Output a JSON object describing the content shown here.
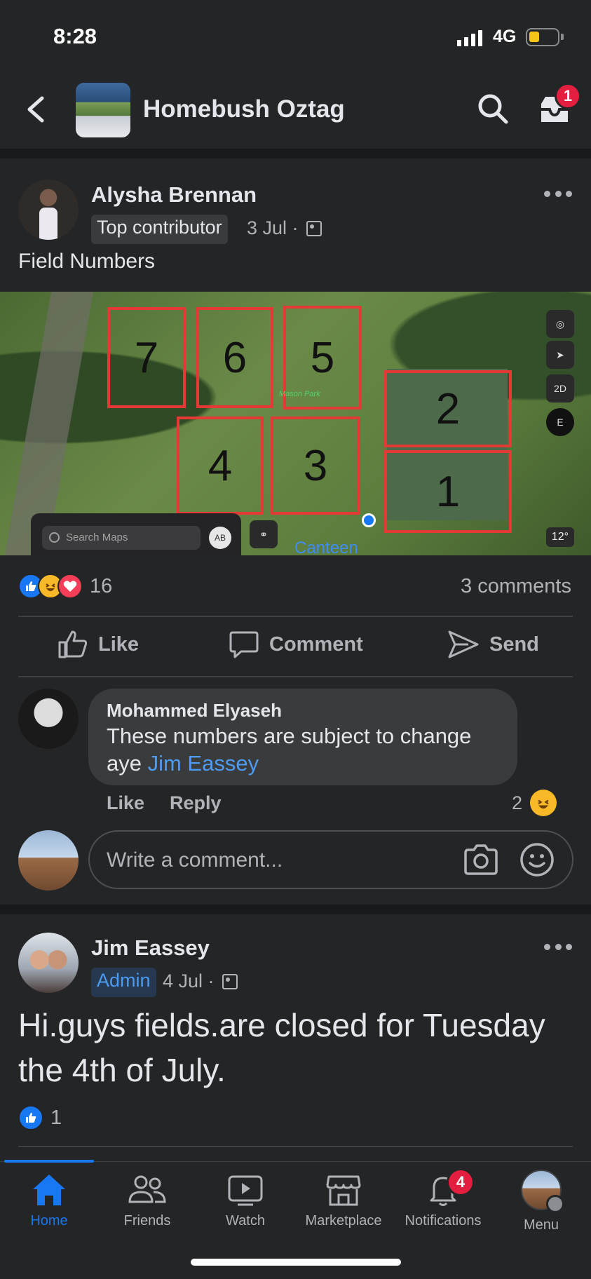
{
  "status_bar": {
    "time": "8:28",
    "network": "4G"
  },
  "header": {
    "title": "Homebush Oztag",
    "inbox_badge": "1"
  },
  "post1": {
    "author": "Alysha Brennan",
    "badge": "Top contributor",
    "date": "3 Jul ·",
    "text": "Field Numbers",
    "map": {
      "field_labels": [
        "7",
        "6",
        "5",
        "2",
        "4",
        "3",
        "1"
      ],
      "park_label": "Mason Park",
      "search_placeholder": "Search Maps",
      "avatar_initials": "AB",
      "canteen_label": "Canteen",
      "control_2d": "2D",
      "compass": "E",
      "temperature": "12°"
    },
    "reaction_count": "16",
    "comments_count": "3 comments",
    "actions": {
      "like": "Like",
      "comment": "Comment",
      "send": "Send"
    }
  },
  "comment": {
    "author": "Mohammed Elyaseh",
    "text": "These numbers are subject to change aye",
    "mention": "Jim Eassey",
    "like_label": "Like",
    "reply_label": "Reply",
    "reaction_count": "2"
  },
  "write_comment": {
    "placeholder": "Write a comment..."
  },
  "post2": {
    "author": "Jim Eassey",
    "badge": "Admin",
    "date": "4 Jul ·",
    "text": "Hi.guys fields.are closed for Tuesday the 4th of July.",
    "reaction_count": "1"
  },
  "bottom_nav": {
    "items": [
      {
        "label": "Home"
      },
      {
        "label": "Friends"
      },
      {
        "label": "Watch"
      },
      {
        "label": "Marketplace"
      },
      {
        "label": "Notifications"
      },
      {
        "label": "Menu"
      }
    ],
    "notifications_badge": "4"
  },
  "colors": {
    "accent": "#1877f2",
    "background": "#242526",
    "badge": "#e41e3f",
    "field_outline": "#e53935"
  }
}
